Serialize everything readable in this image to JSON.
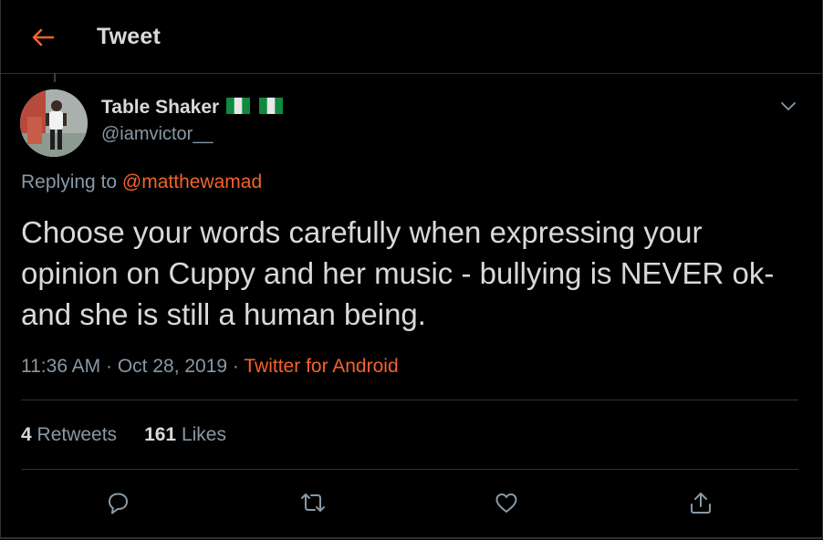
{
  "header": {
    "title": "Tweet",
    "back_icon": "arrow-left-icon"
  },
  "colors": {
    "accent": "#f4622a",
    "background": "#000000",
    "text": "#d9d9d9",
    "muted": "#8899a6",
    "border": "#2f3336"
  },
  "tweet": {
    "author": {
      "display_name": "Table Shaker",
      "flag_icons": [
        "nigeria-flag-icon",
        "nigeria-flag-icon"
      ],
      "handle": "@iamvictor__"
    },
    "replying_prefix": "Replying to ",
    "replying_to": "@matthewamad",
    "text": "Choose your words carefully when expressing your opinion on Cuppy and her music - bullying is NEVER ok- and she is still a human being.",
    "time": "11:36 AM",
    "separator": " · ",
    "date": "Oct 28, 2019",
    "source": "Twitter for Android",
    "stats": {
      "retweets_count": "4",
      "retweets_label": " Retweets",
      "likes_count": "161",
      "likes_label": " Likes"
    },
    "actions": [
      "reply-icon",
      "retweet-icon",
      "like-icon",
      "share-icon"
    ]
  }
}
